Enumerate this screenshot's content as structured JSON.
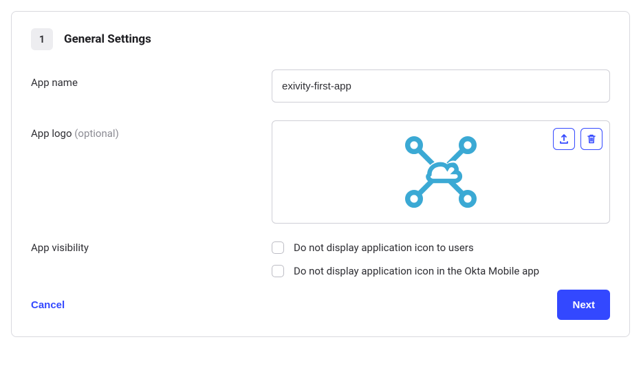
{
  "step": {
    "number": "1",
    "title": "General Settings"
  },
  "fields": {
    "appName": {
      "label": "App name",
      "value": "exivity-first-app"
    },
    "appLogo": {
      "label": "App logo",
      "optional": "(optional)"
    },
    "visibility": {
      "label": "App visibility",
      "option1": "Do not display application icon to users",
      "option2": "Do not display application icon in the Okta Mobile app"
    }
  },
  "footer": {
    "cancel": "Cancel",
    "next": "Next"
  },
  "colors": {
    "primary": "#3348ff",
    "logo": "#3ba9d4"
  }
}
